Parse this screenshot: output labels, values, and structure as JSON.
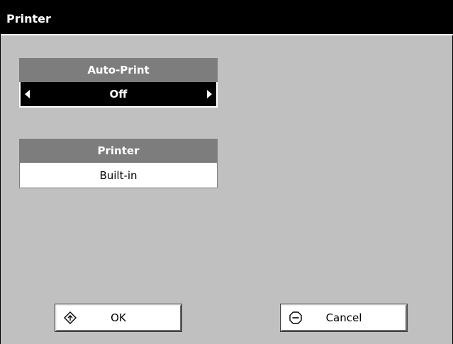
{
  "window": {
    "title": "Printer"
  },
  "auto_print": {
    "header": "Auto-Print",
    "value": "Off"
  },
  "printer": {
    "header": "Printer",
    "value": "Built-in"
  },
  "buttons": {
    "ok_label": "OK",
    "ok_icon": "diamond-arrow-icon",
    "cancel_label": "Cancel",
    "cancel_icon": "stop-sign-icon"
  }
}
